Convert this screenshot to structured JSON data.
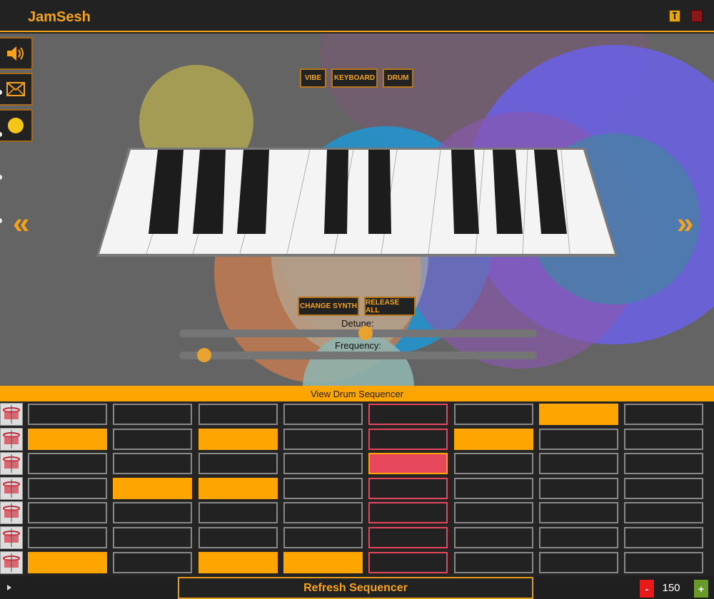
{
  "app": {
    "title": "JamSesh"
  },
  "header": {
    "info_icon": "info-icon",
    "close_icon": "close-icon"
  },
  "side_tools": [
    {
      "name": "volume-icon"
    },
    {
      "name": "mail-icon"
    },
    {
      "name": "record-dot-icon"
    }
  ],
  "modes": [
    "VIBE",
    "KEYBOARD",
    "DRUM"
  ],
  "synth": {
    "change_label": "CHANGE SYNTH",
    "release_label": "RELEASE ALL",
    "detune_label": "Detune:",
    "frequency_label": "Frequency:",
    "detune_value": 0.52,
    "frequency_value": 0.07
  },
  "colors": {
    "accent": "#ffa500",
    "active_step": "#e8485c"
  },
  "sequencer": {
    "header_label": "View Drum Sequencer",
    "instruments": [
      "crash-cymbal-icon",
      "hihat-icon",
      "snare-icon",
      "tom-high-icon",
      "tom-mid-icon",
      "floor-tom-icon",
      "bass-drum-icon"
    ],
    "current_step": 4,
    "grid": [
      [
        0,
        0,
        0,
        0,
        0,
        0,
        1,
        0
      ],
      [
        1,
        0,
        1,
        0,
        0,
        1,
        0,
        0
      ],
      [
        0,
        0,
        0,
        0,
        1,
        0,
        0,
        0
      ],
      [
        0,
        1,
        1,
        0,
        0,
        0,
        0,
        0
      ],
      [
        0,
        0,
        0,
        0,
        0,
        0,
        0,
        0
      ],
      [
        0,
        0,
        0,
        0,
        0,
        0,
        0,
        0
      ],
      [
        1,
        0,
        1,
        1,
        0,
        0,
        0,
        0
      ]
    ]
  },
  "footer": {
    "refresh_label": "Refresh Sequencer",
    "minus_label": "-",
    "plus_label": "+",
    "bpm": "150"
  }
}
